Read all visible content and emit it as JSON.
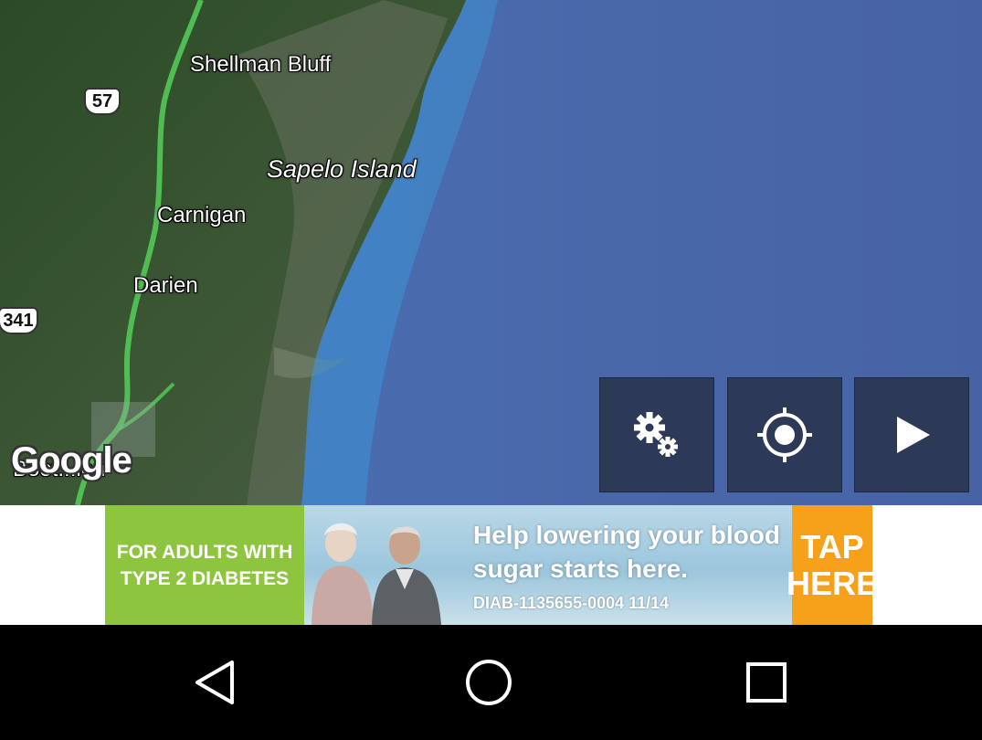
{
  "map": {
    "places": [
      {
        "name": "Shellman Bluff"
      },
      {
        "name": "Sapelo Island"
      },
      {
        "name": "Carnigan"
      },
      {
        "name": "Darien"
      },
      {
        "name": "Boot...ion"
      }
    ],
    "route_shields": [
      "57",
      "341"
    ],
    "attribution": "Google"
  },
  "controls": {
    "icons": [
      "settings-gears-icon",
      "my-location-icon",
      "play-icon"
    ]
  },
  "ad": {
    "left_text": "FOR ADULTS WITH TYPE 2 DIABETES",
    "headline": "Help lowering your blood sugar starts here.",
    "code": "DIAB-1135655-0004 11/14",
    "cta": "TAP HERE",
    "colors": {
      "left": "#8dc53e",
      "cta": "#f7a11a"
    }
  },
  "navbar": {
    "icons": [
      "back-icon",
      "home-icon",
      "recents-icon"
    ]
  }
}
